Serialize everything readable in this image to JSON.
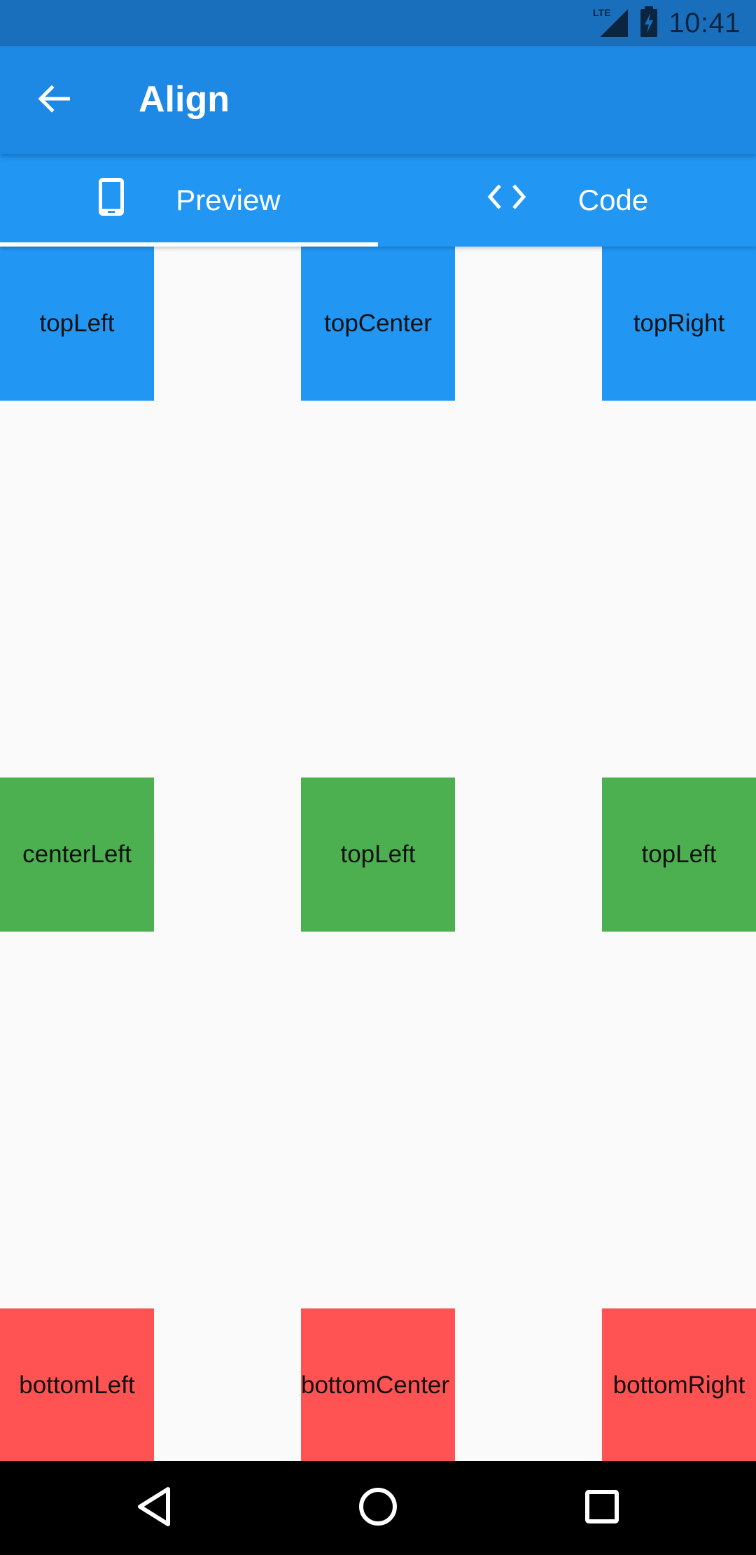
{
  "status_bar": {
    "network": "LTE",
    "time": "10:41",
    "icons": [
      "lte-signal-icon",
      "battery-charging-icon"
    ]
  },
  "app_bar": {
    "title": "Align",
    "back_icon": "arrow-left-icon"
  },
  "tabs": [
    {
      "label": "Preview",
      "icon": "phone-icon",
      "selected": true
    },
    {
      "label": "Code",
      "icon": "code-brackets-icon",
      "selected": false
    }
  ],
  "boxes": {
    "top": [
      "topLeft",
      "topCenter",
      "topRight"
    ],
    "center": [
      "centerLeft",
      "topLeft",
      "topLeft"
    ],
    "bottom": [
      "bottomLeft",
      "bottomCenter",
      "bottomRight"
    ]
  },
  "colors": {
    "status_bar": "#1a6fbd",
    "app_bar": "#1e88e5",
    "tab_bar": "#2196f3",
    "top_row": "#2196f3",
    "center_row": "#4caf50",
    "bottom_row": "#ff5252",
    "background": "#fafafa",
    "nav_bar": "#000000"
  },
  "nav_bar": {
    "icons": [
      "nav-back-icon",
      "nav-home-icon",
      "nav-recents-icon"
    ]
  }
}
